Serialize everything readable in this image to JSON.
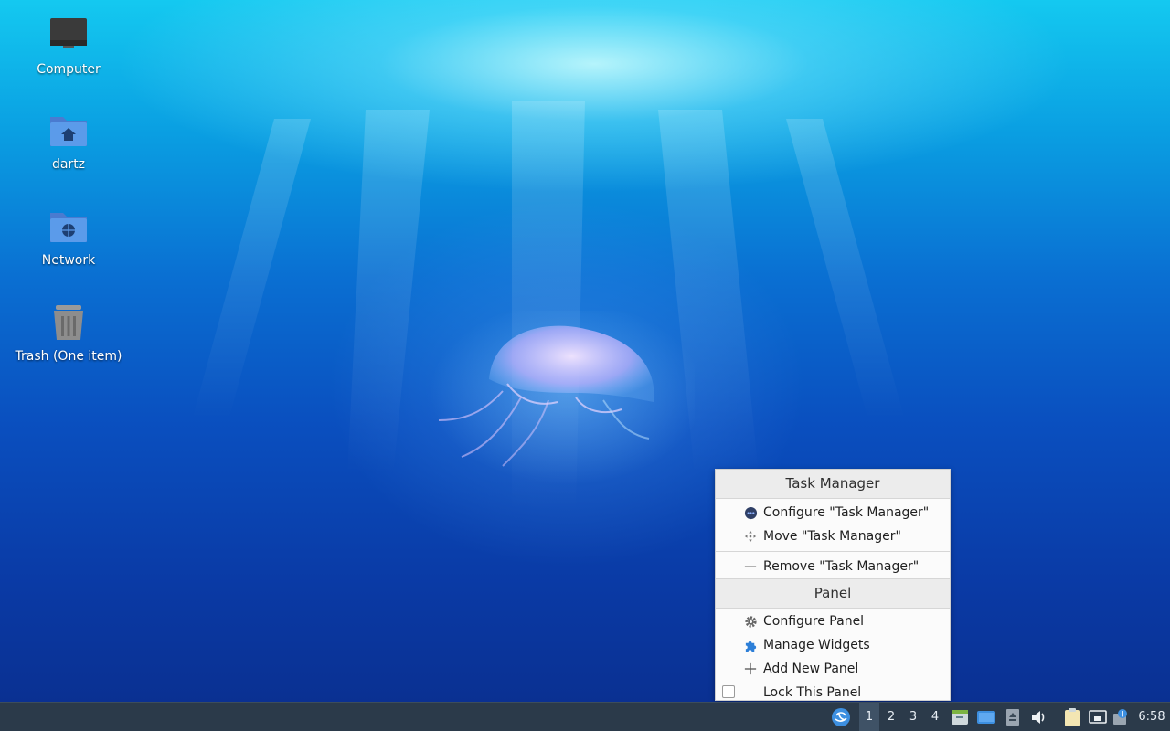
{
  "desktop": {
    "icons": [
      {
        "label": "Computer"
      },
      {
        "label": "dartz"
      },
      {
        "label": "Network"
      },
      {
        "label": "Trash (One item)"
      }
    ]
  },
  "context_menu": {
    "task_manager_title": "Task Manager",
    "configure_label": "Configure \"Task Manager\"",
    "move_label": "Move \"Task Manager\"",
    "remove_label": "Remove \"Task Manager\"",
    "panel_title": "Panel",
    "configure_panel_label": "Configure Panel",
    "manage_widgets_label": "Manage Widgets",
    "add_new_panel_label": "Add New Panel",
    "lock_panel_label": "Lock This Panel",
    "lock_panel_checked": false
  },
  "taskbar": {
    "desktops": [
      "1",
      "2",
      "3",
      "4"
    ],
    "active_desktop": "1",
    "clock": "6:58"
  },
  "colors": {
    "taskbar_bg": "#2b3a4a",
    "accent": "#3d8fe0"
  }
}
